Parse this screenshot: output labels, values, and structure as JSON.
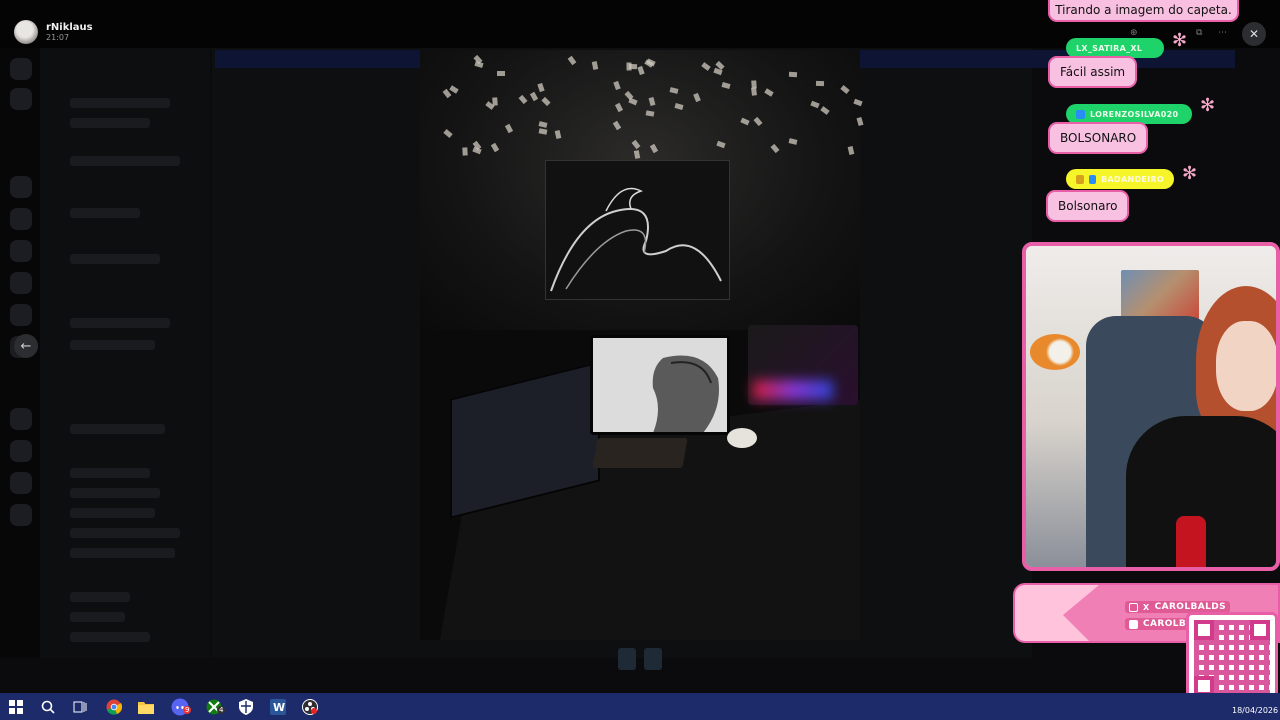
{
  "window": {
    "user_name": "rNiklaus",
    "user_time": "21:07",
    "close_label": "✕",
    "back_label": "←"
  },
  "overlay_chat": {
    "top_message": "Tirando a imagem do capeta.",
    "messages": [
      {
        "user": "LX_SATIRA_XL",
        "text": "Fácil assim",
        "user_color": "#1fd36b",
        "badge_color": "#0a7a3d"
      },
      {
        "user": "LORENZOSILVA020",
        "text": "BOLSONARO",
        "user_color": "#1fd36b",
        "badge_color": "#2a8cf5"
      },
      {
        "user": "BADANDEIRO",
        "text": "Bolsonaro",
        "user_color": "#f5f52a",
        "badge_color": "#d6a11e"
      }
    ],
    "flower_glyph": "✻"
  },
  "socials": {
    "handle_1": "CAROLBALDS",
    "handle_2": "CAROLBALDS",
    "icons": [
      "instagram-icon",
      "x-icon",
      "youtube-icon"
    ]
  },
  "taskbar": {
    "date": "18/04/2026",
    "apps": [
      "windows-start-icon",
      "search-icon",
      "task-view-icon",
      "chrome-icon",
      "file-explorer-icon",
      "discord-icon",
      "xbox-icon",
      "shield-icon",
      "word-icon",
      "obs-icon"
    ],
    "badges": {
      "discord": "9",
      "xbox": "4"
    }
  },
  "colors": {
    "accent_pink": "#e85fa8",
    "bubble_pink": "#f8c1e2",
    "taskbar_blue": "#1d2b6a"
  }
}
